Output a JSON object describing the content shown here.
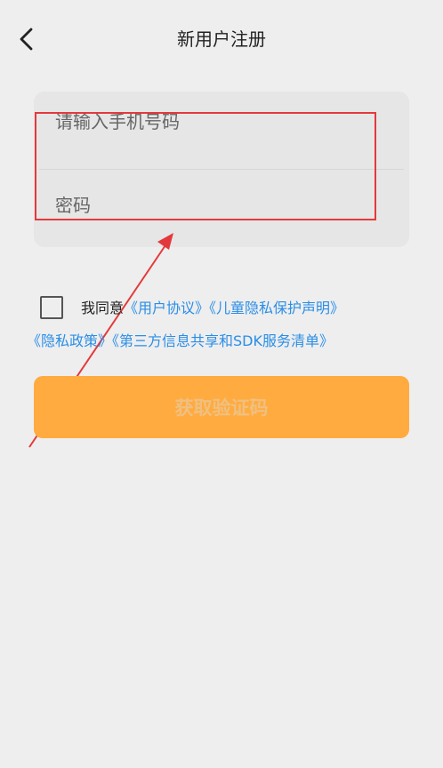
{
  "header": {
    "back_icon": "chevron-left-icon",
    "title": "新用户注册"
  },
  "form": {
    "phone_placeholder": "请输入手机号码",
    "password_placeholder": "密码"
  },
  "agreement": {
    "prefix": "我同意",
    "links": [
      "《用户协议》",
      "《儿童隐私保护声明》",
      "《隐私政策》",
      "《第三方信息共享和SDK服务清单》"
    ],
    "checked": false
  },
  "submit": {
    "label": "获取验证码"
  },
  "colors": {
    "accent": "#ffab40",
    "link": "#2a8ee8",
    "annotation": "#e4393c"
  }
}
